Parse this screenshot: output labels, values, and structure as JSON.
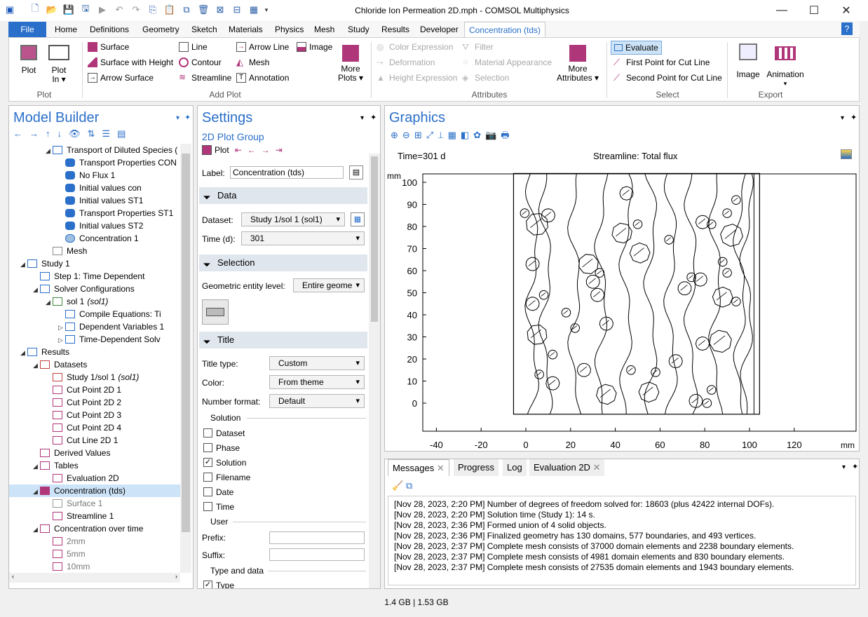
{
  "window": {
    "title": "Chloride Ion Permeation 2D.mph - COMSOL Multiphysics",
    "minimize": "—",
    "maximize": "☐",
    "close": "✕"
  },
  "ribbon_tabs": [
    "File",
    "Home",
    "Definitions",
    "Geometry",
    "Sketch",
    "Materials",
    "Physics",
    "Mesh",
    "Study",
    "Results",
    "Developer",
    "Concentration (tds)"
  ],
  "help": "?",
  "ribbon": {
    "plot": "Plot",
    "plot_in": "Plot",
    "plot_in2": "In ▾",
    "surface": "Surface",
    "surface_height": "Surface with Height",
    "arrow_surface": "Arrow Surface",
    "line": "Line",
    "contour": "Contour",
    "streamline": "Streamline",
    "arrow_line": "Arrow Line",
    "mesh": "Mesh",
    "annotation": "Annotation",
    "image": "Image",
    "more_plots": "More",
    "more_plots2": "Plots ▾",
    "color_expression": "Color Expression",
    "deformation": "Deformation",
    "height_expression": "Height Expression",
    "filter": "Filter",
    "material_appearance": "Material Appearance",
    "selection": "Selection",
    "more_attributes": "More",
    "more_attributes2": "Attributes ▾",
    "evaluate": "Evaluate",
    "first_point": "First Point for Cut Line",
    "second_point": "Second Point for Cut Line",
    "export_image": "Image",
    "animation": "Animation",
    "animation2": "▾",
    "groups": {
      "plot": "Plot",
      "add_plot": "Add Plot",
      "attributes": "Attributes",
      "select": "Select",
      "export": "Export"
    }
  },
  "model_builder": {
    "title": "Model Builder",
    "tree": [
      {
        "label": "Transport of Diluted Species (",
        "depth": 3,
        "tw": "◢",
        "icon": "physics"
      },
      {
        "label": "Transport Properties CON",
        "depth": 4,
        "tw": "",
        "icon": "node-d"
      },
      {
        "label": "No Flux 1",
        "depth": 4,
        "tw": "",
        "icon": "node-d"
      },
      {
        "label": "Initial values con",
        "depth": 4,
        "tw": "",
        "icon": "node-d"
      },
      {
        "label": "Initial values ST1",
        "depth": 4,
        "tw": "",
        "icon": "node"
      },
      {
        "label": "Transport Properties ST1",
        "depth": 4,
        "tw": "",
        "icon": "node"
      },
      {
        "label": "Initial values ST2",
        "depth": 4,
        "tw": "",
        "icon": "node"
      },
      {
        "label": "Concentration 1",
        "depth": 4,
        "tw": "",
        "icon": "conc"
      },
      {
        "label": "Mesh",
        "depth": 3,
        "tw": "",
        "icon": "mesh"
      },
      {
        "label": "Study 1",
        "depth": 1,
        "tw": "◢",
        "icon": "study"
      },
      {
        "label": "Step 1: Time Dependent",
        "depth": 2,
        "tw": "",
        "icon": "step"
      },
      {
        "label": "Solver Configurations",
        "depth": 2,
        "tw": "◢",
        "icon": "solver"
      },
      {
        "label": "sol 1",
        "italic": "(sol1)",
        "depth": 3,
        "tw": "◢",
        "icon": "sol"
      },
      {
        "label": "Compile Equations: Ti",
        "depth": 4,
        "tw": "",
        "icon": "au"
      },
      {
        "label": "Dependent Variables 1",
        "depth": 4,
        "tw": "▷",
        "icon": "uvw"
      },
      {
        "label": "Time-Dependent Solv",
        "depth": 4,
        "tw": "▷",
        "icon": "step"
      },
      {
        "label": "Results",
        "depth": 1,
        "tw": "◢",
        "icon": "results"
      },
      {
        "label": "Datasets",
        "depth": 2,
        "tw": "◢",
        "icon": "datasets"
      },
      {
        "label": "Study 1/sol 1",
        "italic": "(sol1)",
        "depth": 3,
        "tw": "",
        "icon": "ds"
      },
      {
        "label": "Cut Point 2D 1",
        "depth": 3,
        "tw": "",
        "icon": "cut"
      },
      {
        "label": "Cut Point 2D 2",
        "depth": 3,
        "tw": "",
        "icon": "cut"
      },
      {
        "label": "Cut Point 2D 3",
        "depth": 3,
        "tw": "",
        "icon": "cut"
      },
      {
        "label": "Cut Point 2D 4",
        "depth": 3,
        "tw": "",
        "icon": "cut"
      },
      {
        "label": "Cut Line 2D 1",
        "depth": 3,
        "tw": "",
        "icon": "cutline"
      },
      {
        "label": "Derived Values",
        "depth": 2,
        "tw": "",
        "icon": "derived"
      },
      {
        "label": "Tables",
        "depth": 2,
        "tw": "◢",
        "icon": "table"
      },
      {
        "label": "Evaluation 2D",
        "depth": 3,
        "tw": "",
        "icon": "table"
      },
      {
        "label": "Concentration (tds)",
        "depth": 2,
        "tw": "◢",
        "icon": "plotgroup",
        "selected": true
      },
      {
        "label": "Surface 1",
        "depth": 3,
        "tw": "",
        "icon": "surface",
        "grey": true
      },
      {
        "label": "Streamline 1",
        "depth": 3,
        "tw": "",
        "icon": "streamline"
      },
      {
        "label": "Concentration over time",
        "depth": 2,
        "tw": "◢",
        "icon": "plot1d"
      },
      {
        "label": "2mm",
        "depth": 3,
        "tw": "",
        "icon": "plot1d",
        "grey": true
      },
      {
        "label": "5mm",
        "depth": 3,
        "tw": "",
        "icon": "plot1d",
        "grey": true
      },
      {
        "label": "10mm",
        "depth": 3,
        "tw": "",
        "icon": "plot1d",
        "grey": true
      }
    ]
  },
  "settings": {
    "title": "Settings",
    "subtitle": "2D Plot Group",
    "plot_btn": "Plot",
    "label_label": "Label:",
    "label_value": "Concentration (tds)",
    "data_section": "Data",
    "dataset_label": "Dataset:",
    "dataset_value": "Study 1/sol 1 (sol1)",
    "time_label": "Time (d):",
    "time_value": "301",
    "selection_section": "Selection",
    "entity_label": "Geometric entity level:",
    "entity_value": "Entire geome",
    "title_section": "Title",
    "title_type_label": "Title type:",
    "title_type_value": "Custom",
    "color_label": "Color:",
    "color_value": "From theme",
    "number_format_label": "Number format:",
    "number_format_value": "Default",
    "solution_group": "Solution",
    "checks": [
      {
        "label": "Dataset",
        "checked": false
      },
      {
        "label": "Phase",
        "checked": false
      },
      {
        "label": "Solution",
        "checked": true
      },
      {
        "label": "Filename",
        "checked": false
      },
      {
        "label": "Date",
        "checked": false
      },
      {
        "label": "Time",
        "checked": false
      }
    ],
    "user_group": "User",
    "prefix_label": "Prefix:",
    "suffix_label": "Suffix:",
    "type_data_group": "Type and data",
    "type_label": "Type",
    "type_checked": true
  },
  "graphics": {
    "title": "Graphics",
    "time_text": "Time=301 d",
    "streamline_text": "Streamline: Total flux",
    "unit": "mm",
    "x_ticks": [
      "-40",
      "-20",
      "0",
      "20",
      "40",
      "60",
      "80",
      "100",
      "120"
    ],
    "y_ticks": [
      "100",
      "90",
      "80",
      "70",
      "60",
      "50",
      "40",
      "30",
      "20",
      "10",
      "0"
    ]
  },
  "messages": {
    "tabs": [
      "Messages",
      "Progress",
      "Log",
      "Evaluation 2D"
    ],
    "lines": [
      "[Nov 28, 2023, 2:20 PM] Number of degrees of freedom solved for: 18603 (plus 42422 internal DOFs).",
      "[Nov 28, 2023, 2:20 PM] Solution time (Study 1): 14 s.",
      "[Nov 28, 2023, 2:36 PM] Formed union of 4 solid objects.",
      "[Nov 28, 2023, 2:36 PM] Finalized geometry has 130 domains, 577 boundaries, and 493 vertices.",
      "[Nov 28, 2023, 2:37 PM] Complete mesh consists of 37000 domain elements and 2238 boundary elements.",
      "[Nov 28, 2023, 2:37 PM] Complete mesh consists of 4981 domain elements and 830 boundary elements.",
      "[Nov 28, 2023, 2:37 PM] Complete mesh consists of 27535 domain elements and 1943 boundary elements."
    ]
  },
  "status": {
    "memory": "1.4 GB | 1.53 GB"
  },
  "colors": {
    "accent": "#2a6fc9",
    "plotgroup": "#b0367a",
    "selected_row": "#cde3f7"
  }
}
